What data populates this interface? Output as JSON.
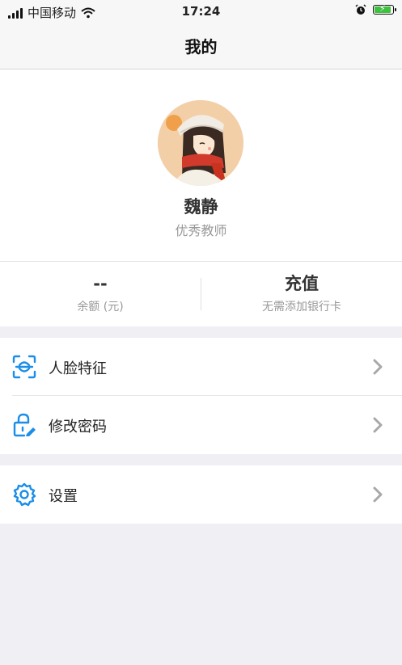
{
  "status_bar": {
    "carrier": "中国移动",
    "time": "17:24",
    "icons": [
      "signal-icon",
      "wifi-icon",
      "alarm-icon",
      "battery-charging-icon"
    ],
    "battery_color": "#3fc13f"
  },
  "nav": {
    "title": "我的"
  },
  "profile": {
    "name": "魏静",
    "role": "优秀教师"
  },
  "stats": {
    "balance_value": "--",
    "balance_label": "余额 (元)",
    "recharge_value": "充值",
    "recharge_label": "无需添加银行卡"
  },
  "menu": {
    "items": [
      {
        "label": "人脸特征",
        "icon": "face-scan-icon"
      },
      {
        "label": "修改密码",
        "icon": "lock-edit-icon"
      },
      {
        "label": "设置",
        "icon": "gear-icon"
      }
    ]
  },
  "colors": {
    "accent": "#1a8ee8",
    "background": "#efeff4"
  }
}
